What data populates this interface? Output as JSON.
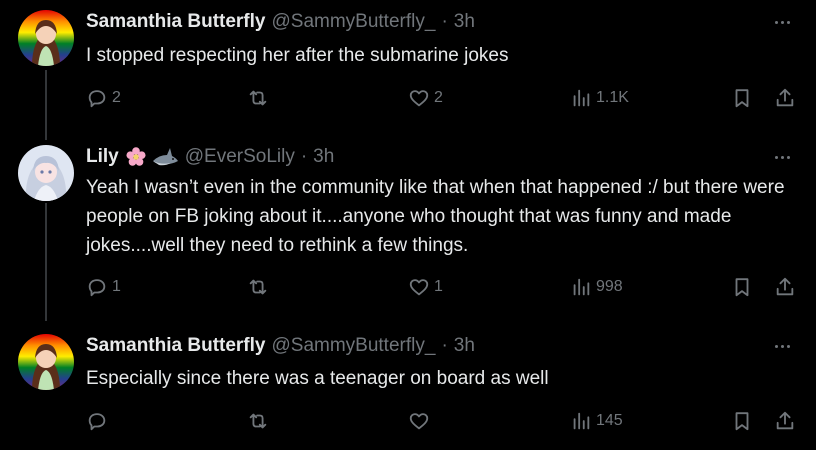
{
  "tweets": [
    {
      "name": "Samanthia Butterfly",
      "handle": "@SammyButterfly_",
      "separator": "·",
      "time": "3h",
      "text": "I stopped respecting her after the submarine jokes",
      "replies": "2",
      "retweets": "",
      "likes": "2",
      "views": "1.1K"
    },
    {
      "name": "Lily",
      "emoji": [
        "cherry-blossom",
        "shark"
      ],
      "handle": "@EverSoLily",
      "separator": "·",
      "time": "3h",
      "text": "Yeah I wasn’t even in the community like that when that happened :/ but there were people on FB joking about it....anyone who thought that was funny and made jokes....well they need to rethink a few things.",
      "replies": "1",
      "retweets": "",
      "likes": "1",
      "views": "998"
    },
    {
      "name": "Samanthia Butterfly",
      "handle": "@SammyButterfly_",
      "separator": "·",
      "time": "3h",
      "text": "Especially since there was a teenager on board as well",
      "replies": "",
      "retweets": "",
      "likes": "",
      "views": "145"
    }
  ],
  "colors": {
    "background": "#000000",
    "text": "#e7e9ea",
    "muted": "#71767b",
    "thread_line": "#333639"
  }
}
